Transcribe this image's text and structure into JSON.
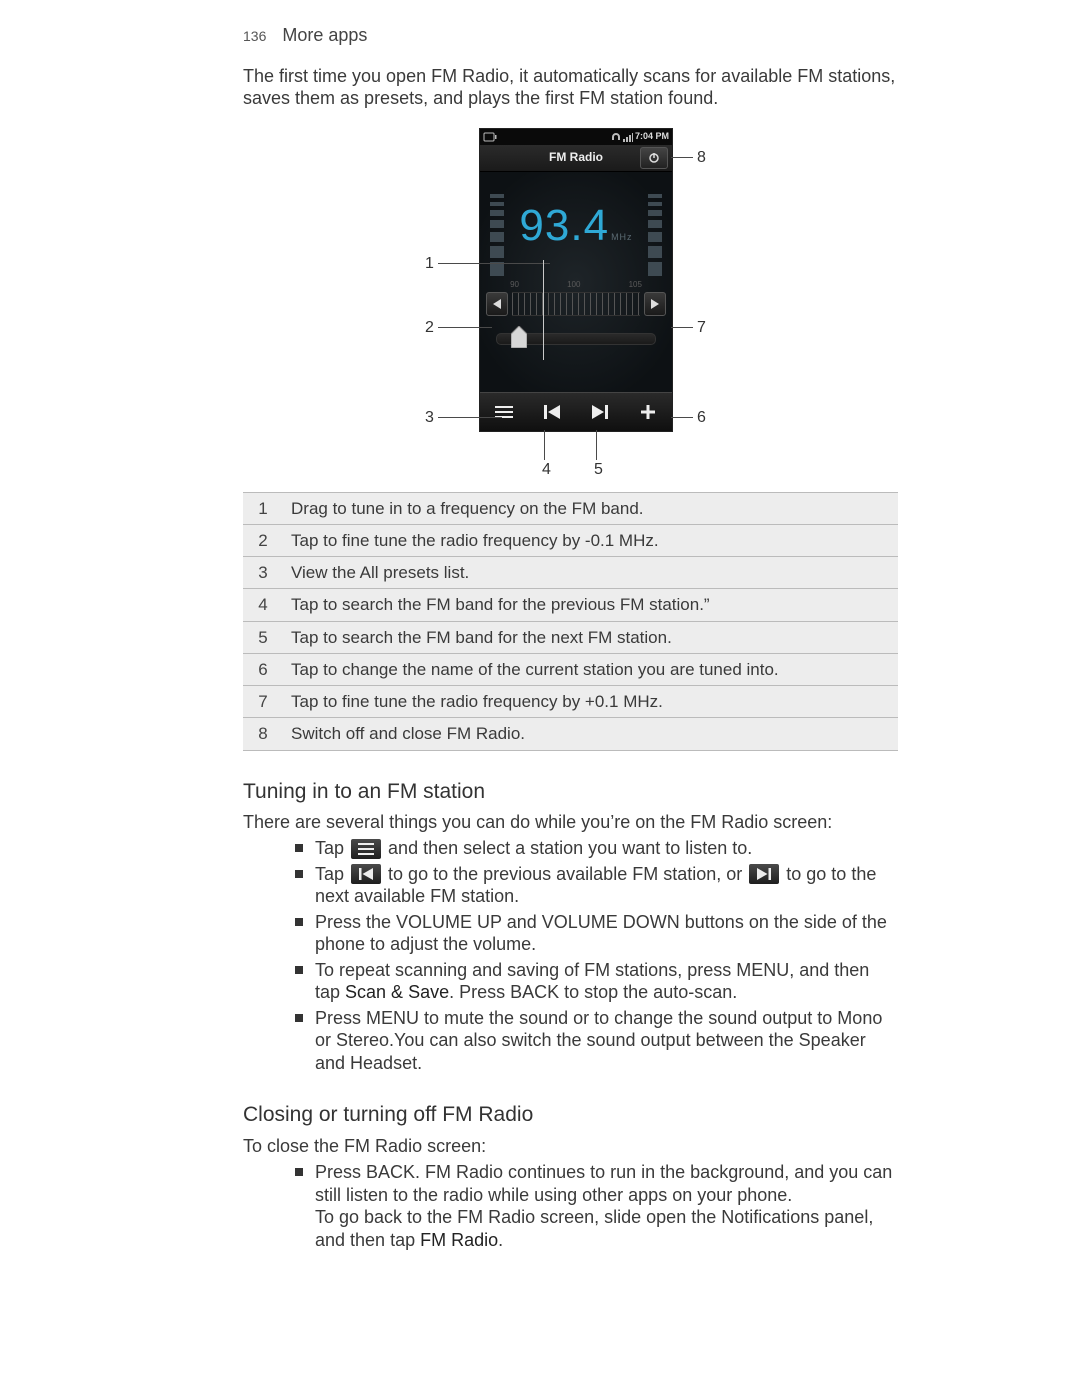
{
  "header": {
    "page_number": "136",
    "section": "More apps"
  },
  "intro": "The first time you open FM Radio, it automatically scans for available FM stations, saves them as presets, and plays the first FM station found.",
  "phone": {
    "status_time": "7:04 PM",
    "title": "FM Radio",
    "frequency": "93.4",
    "freq_unit": "MHz",
    "dial_labels": [
      "90",
      "100",
      "105"
    ]
  },
  "callouts": {
    "1": "1",
    "2": "2",
    "3": "3",
    "4": "4",
    "5": "5",
    "6": "6",
    "7": "7",
    "8": "8"
  },
  "legend": [
    {
      "n": "1",
      "t": "Drag to tune in to a frequency on the FM band."
    },
    {
      "n": "2",
      "t": "Tap to fine tune the radio frequency by -0.1 MHz."
    },
    {
      "n": "3",
      "t": "View the All presets list."
    },
    {
      "n": "4",
      "t": "Tap to search the FM band for the previous FM station.”"
    },
    {
      "n": "5",
      "t": "Tap to search the FM band for the next FM station."
    },
    {
      "n": "6",
      "t": "Tap to change the name of the current station you are tuned into."
    },
    {
      "n": "7",
      "t": "Tap to fine tune the radio frequency by +0.1 MHz."
    },
    {
      "n": "8",
      "t": "Switch off and close FM Radio."
    }
  ],
  "tuning": {
    "heading": "Tuning in to an FM station",
    "intro": "There are several things you can do while you’re on the FM Radio screen:",
    "b1_a": "Tap ",
    "b1_b": " and then select a station you want to listen to.",
    "b2_a": "Tap ",
    "b2_b": " to go to the previous available FM station, or ",
    "b2_c": " to go to the next available FM station.",
    "b3": "Press the VOLUME UP and VOLUME DOWN buttons on the side of the phone to adjust the volume.",
    "b4_a": "To repeat scanning and saving of FM stations, press MENU, and then tap ",
    "b4_scan": "Scan & Save",
    "b4_b": ". Press BACK to stop the auto-scan.",
    "b5": "Press MENU to mute the sound or to change the sound output to Mono or Stereo.You can also switch the sound output between the Speaker and Headset."
  },
  "closing": {
    "heading": "Closing or turning off FM Radio",
    "intro": "To close the FM Radio screen:",
    "b1_a": "Press BACK. FM Radio continues to run in the background, and you can still listen to the radio while using other apps on your phone.",
    "b1_b_a": "To go back to the FM Radio screen, slide open the Notifications panel, and then tap ",
    "b1_b_app": "FM Radio",
    "b1_b_b": "."
  }
}
